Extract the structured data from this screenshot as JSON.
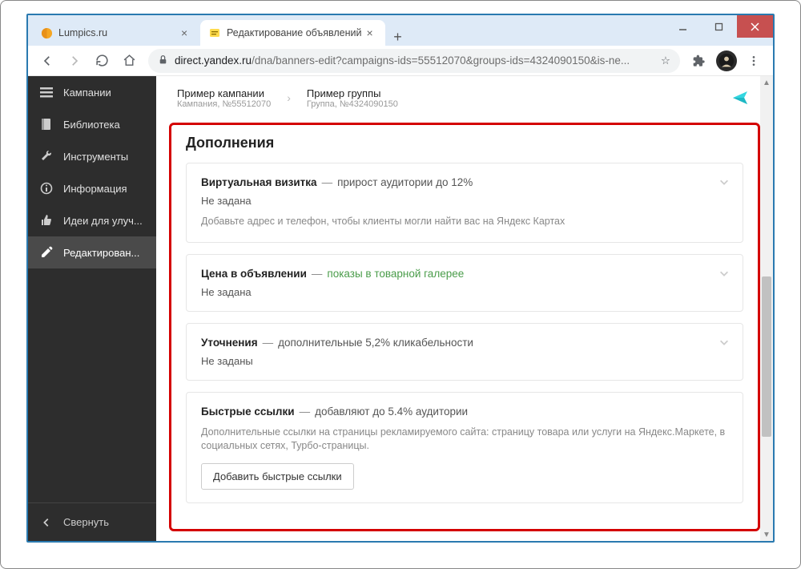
{
  "window": {
    "tabs": [
      {
        "title": "Lumpics.ru"
      },
      {
        "title": "Редактирование объявлений"
      }
    ]
  },
  "address": {
    "host": "direct.yandex.ru",
    "path": "/dna/banners-edit?campaigns-ids=55512070&groups-ids=4324090150&is-ne..."
  },
  "sidebar": {
    "items": [
      {
        "label": "Кампании"
      },
      {
        "label": "Библиотека"
      },
      {
        "label": "Инструменты"
      },
      {
        "label": "Информация"
      },
      {
        "label": "Идеи для улуч..."
      },
      {
        "label": "Редактирован..."
      }
    ],
    "collapse": "Свернуть"
  },
  "breadcrumb": {
    "campaign_title": "Пример кампании",
    "campaign_sub": "Кампания, №55512070",
    "group_title": "Пример группы",
    "group_sub": "Группа, №4324090150"
  },
  "section": {
    "title": "Дополнения",
    "cards": [
      {
        "title": "Виртуальная визитка",
        "dash": "—",
        "suffix": "прирост аудитории до 12%",
        "suffix_green": false,
        "status": "Не задана",
        "desc": "Добавьте адрес и телефон, чтобы клиенты могли найти вас на Яндекс Картах",
        "button": ""
      },
      {
        "title": "Цена в объявлении",
        "dash": "—",
        "suffix": "показы в товарной галерее",
        "suffix_green": true,
        "status": "Не задана",
        "desc": "",
        "button": ""
      },
      {
        "title": "Уточнения",
        "dash": "—",
        "suffix": "дополнительные 5,2% кликабельности",
        "suffix_green": false,
        "status": "Не заданы",
        "desc": "",
        "button": ""
      },
      {
        "title": "Быстрые ссылки",
        "dash": "—",
        "suffix": "добавляют до 5.4% аудитории",
        "suffix_green": false,
        "status": "",
        "desc": "Дополнительные ссылки на страницы рекламируемого сайта: страницу товара или услуги на Яндекс.Маркете, в социальных сетях, Турбо-страницы.",
        "button": "Добавить быстрые ссылки"
      }
    ]
  }
}
